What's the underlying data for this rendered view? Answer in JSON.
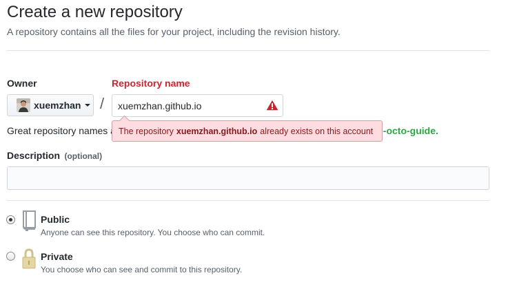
{
  "header": {
    "title": "Create a new repository",
    "subtitle": "A repository contains all the files for your project, including the revision history."
  },
  "owner": {
    "label": "Owner",
    "selected": "xuemzhan"
  },
  "separator": "/",
  "repository_name": {
    "label": "Repository name",
    "value": "xuemzhan.github.io"
  },
  "error": {
    "prefix": "The repository",
    "repo": "xuemzhan.github.io",
    "suffix": "already exists on this account"
  },
  "hint": {
    "text_start": "Great repository names a",
    "suggestion": "e-octo-guide."
  },
  "description": {
    "label": "Description",
    "optional": "(optional)",
    "value": ""
  },
  "visibility": {
    "selected": "public",
    "public": {
      "title": "Public",
      "description": "Anyone can see this repository. You choose who can commit.",
      "icon": "repo-book-icon"
    },
    "private": {
      "title": "Private",
      "description": "You choose who can see and commit to this repository.",
      "icon": "lock-icon"
    }
  },
  "colors": {
    "error_text": "#86181d",
    "error_bg": "#ffdce0",
    "label_error": "#cb2431",
    "suggestion_green": "#28a745",
    "warning_red": "#cb2431"
  }
}
